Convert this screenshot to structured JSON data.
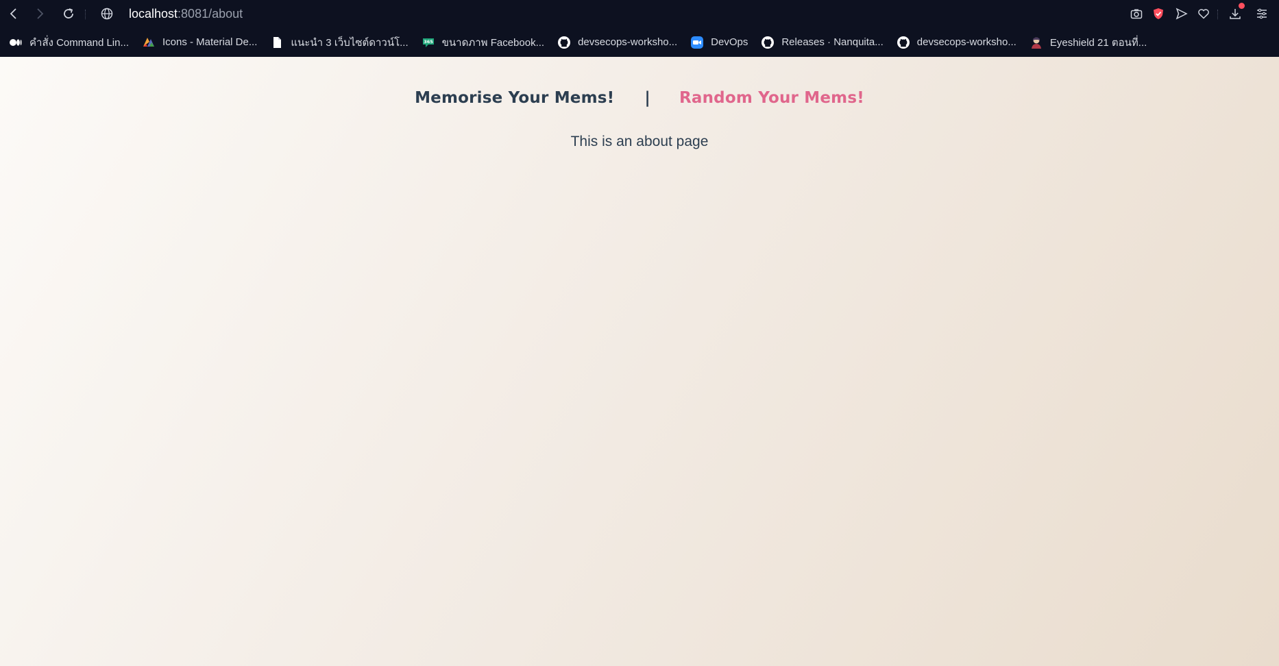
{
  "browser": {
    "url_host": "localhost",
    "url_path": ":8081/about",
    "icons": {
      "back": "back-arrow-icon",
      "forward": "forward-arrow-icon",
      "reload": "reload-icon",
      "site": "globe-icon",
      "camera": "camera-icon",
      "shield": "shield-icon",
      "send": "send-icon",
      "heart": "heart-icon",
      "download": "download-icon",
      "menu": "menu-icon"
    },
    "colors": {
      "bar": "#0d1120",
      "shield": "#ff4f5e"
    }
  },
  "bookmarks": [
    {
      "label": "คำสั่ง Command Lin...",
      "icon": "medium-icon"
    },
    {
      "label": "Icons - Material De...",
      "icon": "material-icon"
    },
    {
      "label": "แนะนำ 3 เว็บไซต์ดาวน์โ...",
      "icon": "file-icon"
    },
    {
      "label": "ขนาดภาพ Facebook...",
      "icon": "365-icon"
    },
    {
      "label": "devsecops-worksho...",
      "icon": "github-icon"
    },
    {
      "label": "DevOps",
      "icon": "zoom-icon"
    },
    {
      "label": "Releases · Nanquita...",
      "icon": "github-icon"
    },
    {
      "label": "devsecops-worksho...",
      "icon": "github-icon"
    },
    {
      "label": "Eyeshield 21 ตอนที่...",
      "icon": "avatar-icon"
    }
  ],
  "page": {
    "nav": {
      "home": "Memorise Your Mems!",
      "separator": "|",
      "random": "Random Your Mems!"
    },
    "content": "This is an about page",
    "colors": {
      "text": "#2c3e50",
      "accent": "#e0668c"
    }
  }
}
